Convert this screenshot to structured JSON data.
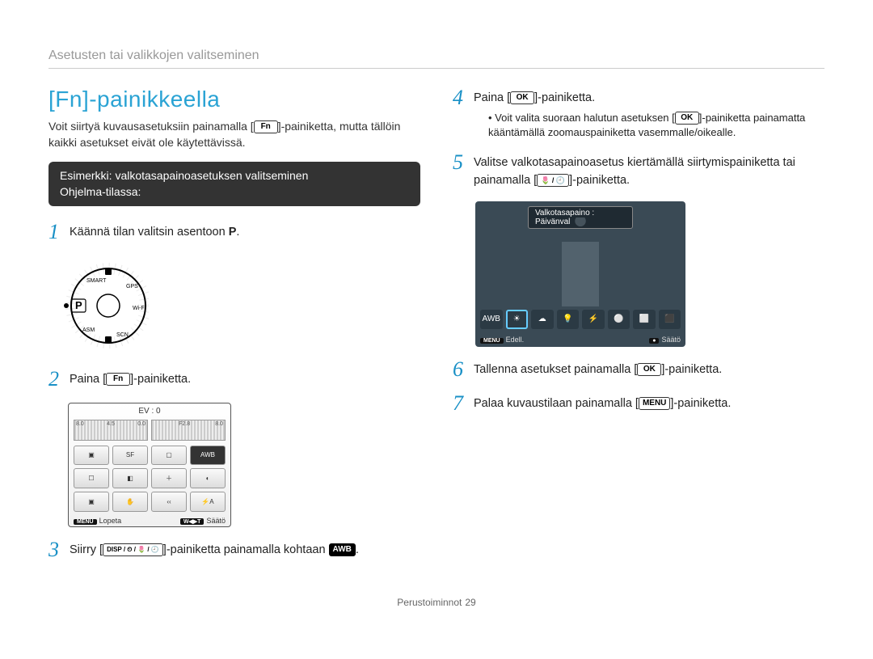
{
  "breadcrumb": "Asetusten tai valikkojen valitseminen",
  "heading": "[Fn]-painikkeella",
  "intro": {
    "p1a": "Voit siirtyä kuvausasetuksiin painamalla [",
    "p1_fn": "Fn",
    "p1b": "]-painiketta, mutta tällöin kaikki asetukset eivät ole käytettävissä."
  },
  "example_box": {
    "line1": "Esimerkki: valkotasapainoasetuksen valitseminen",
    "line2": "Ohjelma-tilassa:"
  },
  "steps": {
    "s1": {
      "num": "1",
      "p1": "Käännä tilan valitsin asentoon ",
      "p2_mode": "P",
      "p3": "."
    },
    "s2": {
      "num": "2",
      "p1": "Paina [",
      "p2_fn": "Fn",
      "p3": "]-painiketta."
    },
    "s3": {
      "num": "3",
      "p1": "Siirry [",
      "group": "DISP / ⏲ / 🌷 / 🕘",
      "p2": "]-painiketta painamalla kohtaan ",
      "p3_icon": "AWB",
      "p4": "."
    },
    "s4": {
      "num": "4",
      "p1": "Paina [",
      "p2_ok": "OK",
      "p3": "]-painiketta.",
      "bullet_a": "Voit valita suoraan halutun asetuksen [",
      "bullet_b": "]-painiketta painamatta kääntämällä zoomauspainiketta vasemmalle/oikealle."
    },
    "s5": {
      "num": "5",
      "p1": "Valitse valkotasapainoasetus kiertämällä siirtymispainiketta tai painamalla [",
      "group": "🌷 / 🕘",
      "p2": "]-painiketta."
    },
    "s6": {
      "num": "6",
      "p1": "Tallenna asetukset painamalla [",
      "p2_ok": "OK",
      "p3": "]-painiketta."
    },
    "s7": {
      "num": "7",
      "p1": "Palaa kuvaustilaan painamalla [",
      "p2_menu": "MENU",
      "p3": "]-painiketta."
    }
  },
  "screen1": {
    "ev_label": "EV : 0",
    "scale_left": [
      "8.0",
      "4.5",
      "0.0"
    ],
    "scale_right": [
      "F2.8",
      "8.0"
    ],
    "footer_left_pill": "MENU",
    "footer_left_text": "Lopeta",
    "footer_right_pill": "W◀▶T",
    "footer_right_text": "Säätö"
  },
  "screen2": {
    "pill": "Valkotasapaino : Päivänval",
    "icons": [
      "AWB",
      "☀",
      "☁",
      "💡",
      "⚡",
      "⚪",
      "⬜",
      "⬛"
    ],
    "selected_index": 1,
    "footer_left_pill": "MENU",
    "footer_left_text": "Edell.",
    "footer_right_pill": "●",
    "footer_right_text": "Säätö"
  },
  "dial": {
    "labels": [
      "SMART",
      "GPS",
      "Wi-Fi",
      "SCN",
      "ASM"
    ],
    "selected": "P"
  },
  "footer": {
    "section": "Perustoiminnot",
    "page": "29"
  }
}
